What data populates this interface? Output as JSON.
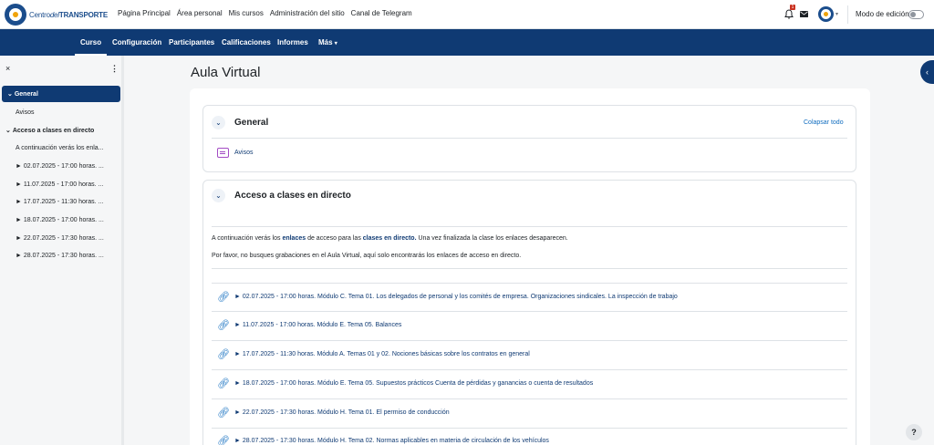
{
  "brand": {
    "name_part1": "Centro",
    "name_part2": "del",
    "name_part3": "TRANSPORTE"
  },
  "topnav": [
    "Página Principal",
    "Área personal",
    "Mis cursos",
    "Administración del sitio",
    "Canal de Telegram"
  ],
  "notifications": {
    "count": "1"
  },
  "edit_mode": {
    "label": "Modo de edición",
    "enabled": false
  },
  "secnav": {
    "tabs": [
      "Curso",
      "Configuración",
      "Participantes",
      "Calificaciones",
      "Informes",
      "Más"
    ],
    "active": "Curso"
  },
  "drawer": {
    "close_symbol": "×",
    "menu_symbol": "⋮",
    "items": [
      {
        "label": "General"
      },
      {
        "label": "Avisos"
      },
      {
        "label": "Acceso a clases en directo"
      },
      {
        "label": "A continuación verás los enla..."
      },
      {
        "label": "► 02.07.2025 - 17:00 horas. ..."
      },
      {
        "label": "► 11.07.2025 - 17:00 horas. ..."
      },
      {
        "label": "► 17.07.2025 - 11:30 horas. ..."
      },
      {
        "label": "► 18.07.2025 - 17:00 horas. ..."
      },
      {
        "label": "► 22.07.2025 - 17:30 horas. ..."
      },
      {
        "label": "► 28.07.2025 - 17:30 horas. ..."
      }
    ]
  },
  "page": {
    "title": "Aula Virtual"
  },
  "sections": {
    "general": {
      "title": "General",
      "collapse_all": "Colapsar todo",
      "activity": "Avisos"
    },
    "live": {
      "title": "Acceso a clases en directo",
      "summary_1a": "A continuación verás los ",
      "summary_1b": "enlaces",
      "summary_1c": " de acceso para las ",
      "summary_1d": "clases en directo.",
      "summary_1e": " Una vez finalizada la clase los enlaces desaparecen.",
      "summary_2": "Por favor, no busques grabaciones en el Aula Virtual, aquí solo encontrarás los enlaces de acceso en directo.",
      "links": [
        "► 02.07.2025 - 17:00 horas. Módulo C. Tema 01. Los delegados de personal y los comités de empresa. Organizaciones sindicales. La inspección de trabajo",
        "► 11.07.2025 - 17:00 horas. Módulo E. Tema 05. Balances",
        "► 17.07.2025 - 11:30 horas. Módulo A. Temas 01 y 02. Nociones básicas sobre los contratos en general",
        "► 18.07.2025 - 17:00 horas. Módulo E. Tema 05. Supuestos prácticos Cuenta de pérdidas y ganancias o cuenta de resultados",
        "► 22.07.2025 - 17:30 horas. Módulo H. Tema 01. El permiso de conducción",
        "► 28.07.2025 - 17:30 horas. Módulo H. Tema 02. Normas aplicables en materia de circulación de los vehículos"
      ]
    }
  },
  "help": {
    "label": "?"
  },
  "colors": {
    "primary": "#0f3a73",
    "link": "#0f6cbf",
    "forum_icon": "#a34bc4",
    "accent": "#f0a30a"
  },
  "icons": [
    "bell-icon",
    "mail-icon",
    "chevron-down-icon",
    "link-icon",
    "forum-icon",
    "chevron-left-icon",
    "close-icon",
    "kebab-menu-icon"
  ]
}
